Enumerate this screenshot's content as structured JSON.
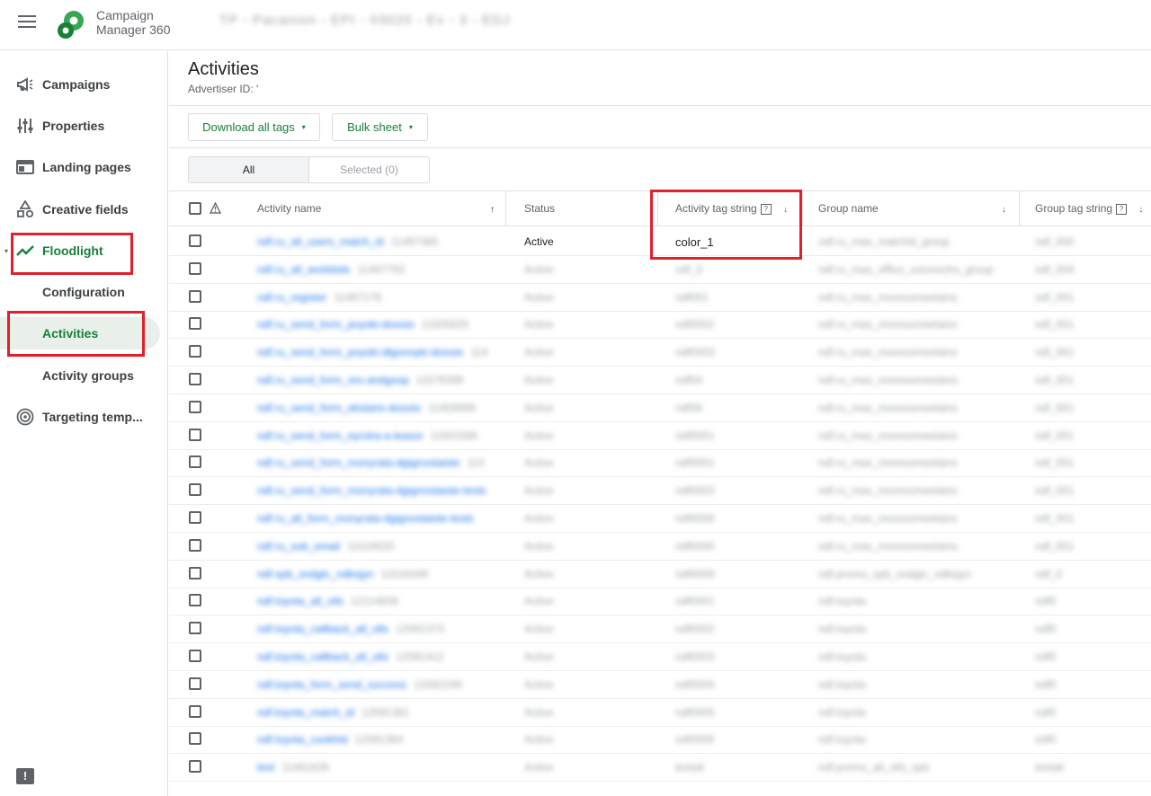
{
  "app": {
    "brand_line1": "Campaign",
    "brand_line2": "Manager 360",
    "account": "TP - Pacanion - EPI - 03020 - Ev - 3 - EDJ"
  },
  "sidebar": {
    "items": [
      {
        "label": "Campaigns",
        "icon": "megaphone-icon"
      },
      {
        "label": "Properties",
        "icon": "tune-icon"
      },
      {
        "label": "Landing pages",
        "icon": "web-icon"
      },
      {
        "label": "Creative fields",
        "icon": "shapes-icon"
      },
      {
        "label": "Floodlight",
        "icon": "trending-icon"
      },
      {
        "label": "Configuration"
      },
      {
        "label": "Activities"
      },
      {
        "label": "Activity groups"
      },
      {
        "label": "Targeting temp...",
        "icon": "target-icon"
      }
    ],
    "feedback": "!"
  },
  "header": {
    "title": "Activities",
    "advertiser_id": "Advertiser ID: '"
  },
  "toolbar": {
    "download_label": "Download all tags",
    "bulk_label": "Bulk sheet",
    "caret": "▾"
  },
  "filter": {
    "all_label": "All",
    "selected_label": "Selected (0)"
  },
  "table": {
    "columns": {
      "activity_name": "Activity name",
      "status": "Status",
      "activity_tag": "Activity tag string",
      "group_name": "Group name",
      "group_tag": "Group tag string",
      "help": "?",
      "sort_up": "↑",
      "sort_down": "↓"
    },
    "rows": [
      {
        "name": "ndf.ru_all_users_match_id",
        "id": "11497385",
        "status": "Active",
        "tag": "color_1",
        "group": "ndf.ru_max_matchid_group",
        "gtag": "ndf_000"
      },
      {
        "name": "ndf.ru_all_workbids",
        "id": "11497750",
        "status": "Active",
        "tag": "ndf_0",
        "group": "ndf.ru_max_office_voronezhs_group",
        "gtag": "ndf_004"
      },
      {
        "name": "ndf.ru_register",
        "id": "11497178",
        "status": "Active",
        "tag": "ndf001",
        "group": "ndf.ru_max_moresomeelains",
        "gtag": "ndf_001"
      },
      {
        "name": "ndf.ru_send_form_poyski-doooio",
        "id": "11505625",
        "status": "Active",
        "tag": "ndf0002",
        "group": "ndf.ru_max_moresomeelains",
        "gtag": "ndf_001"
      },
      {
        "name": "ndf.ru_send_form_poyski-dlgonoyki-doooio",
        "id": "114",
        "status": "Active",
        "tag": "ndf0003",
        "group": "ndf.ru_max_moresomeelains",
        "gtag": "ndf_001"
      },
      {
        "name": "ndf.ru_send_form_oro-andgoop",
        "id": "11576399",
        "status": "Active",
        "tag": "ndf04",
        "group": "ndf.ru_max_moresomeelains",
        "gtag": "ndf_001"
      },
      {
        "name": "ndf.ru_send_form_ekstaris-doooio",
        "id": "11459999",
        "status": "Active",
        "tag": "ndf06",
        "group": "ndf.ru_max_moresomeelains",
        "gtag": "ndf_001"
      },
      {
        "name": "ndf.ru_send_form_eyrstra-a-leasor",
        "id": "11501566",
        "status": "Active",
        "tag": "ndf0001",
        "group": "ndf.ru_max_moresomeelains",
        "gtag": "ndf_001"
      },
      {
        "name": "ndf.ru_send_form_monyrata-dgignostaiste",
        "id": "114",
        "status": "Active",
        "tag": "ndf0001",
        "group": "ndf.ru_max_moresomeelains",
        "gtag": "ndf_001"
      },
      {
        "name": "ndf.ru_send_form_monyrata-dgignostaiste-tests",
        "id": "",
        "status": "Active",
        "tag": "ndf0003",
        "group": "ndf.ru_max_moresomeelains",
        "gtag": "ndf_001"
      },
      {
        "name": "ndf.ru_all_form_monyrata-dgignostaiste-tests",
        "id": "",
        "status": "Active",
        "tag": "ndf0008",
        "group": "ndf.ru_max_moresomeelains",
        "gtag": "ndf_001"
      },
      {
        "name": "ndf.ru_sub_email",
        "id": "11524025",
        "status": "Active",
        "tag": "ndf0000",
        "group": "ndf.ru_max_moresomeelains",
        "gtag": "ndf_001"
      },
      {
        "name": "ndf.spb_sndgtc_ndbsjyn",
        "id": "11516349",
        "status": "Active",
        "tag": "ndf0009",
        "group": "ndf.promo_spb_sndgtc_ndbsjyn",
        "gtag": "ndf_0"
      },
      {
        "name": "ndf.toyota_all_olls",
        "id": "12114839",
        "status": "Active",
        "tag": "ndf0001",
        "group": "ndf.toyota",
        "gtag": "ndf0"
      },
      {
        "name": "ndf.toyota_callback_all_olls",
        "id": "12091373",
        "status": "Active",
        "tag": "ndf0002",
        "group": "ndf.toyota",
        "gtag": "ndf0"
      },
      {
        "name": "ndf.toyota_callback_all_olls",
        "id": "12091412",
        "status": "Active",
        "tag": "ndf0003",
        "group": "ndf.toyota",
        "gtag": "ndf0"
      },
      {
        "name": "ndf.toyota_form_send_success",
        "id": "12092249",
        "status": "Active",
        "tag": "ndf0004",
        "group": "ndf.toyota",
        "gtag": "ndf0"
      },
      {
        "name": "ndf.toyota_match_id",
        "id": "12091361",
        "status": "Active",
        "tag": "ndf0005",
        "group": "ndf.toyota",
        "gtag": "ndf0"
      },
      {
        "name": "ndf.toyota_cookhid",
        "id": "12091364",
        "status": "Active",
        "tag": "ndf0006",
        "group": "ndf.toyota",
        "gtag": "ndf0"
      },
      {
        "name": "test",
        "id": "11461626",
        "status": "Active",
        "tag": "testalt",
        "group": "ndf.promo_all_olls_spb",
        "gtag": "testalt"
      }
    ]
  },
  "colors": {
    "accent": "#188038",
    "link": "#1a73e8",
    "highlight": "#e0202a"
  }
}
